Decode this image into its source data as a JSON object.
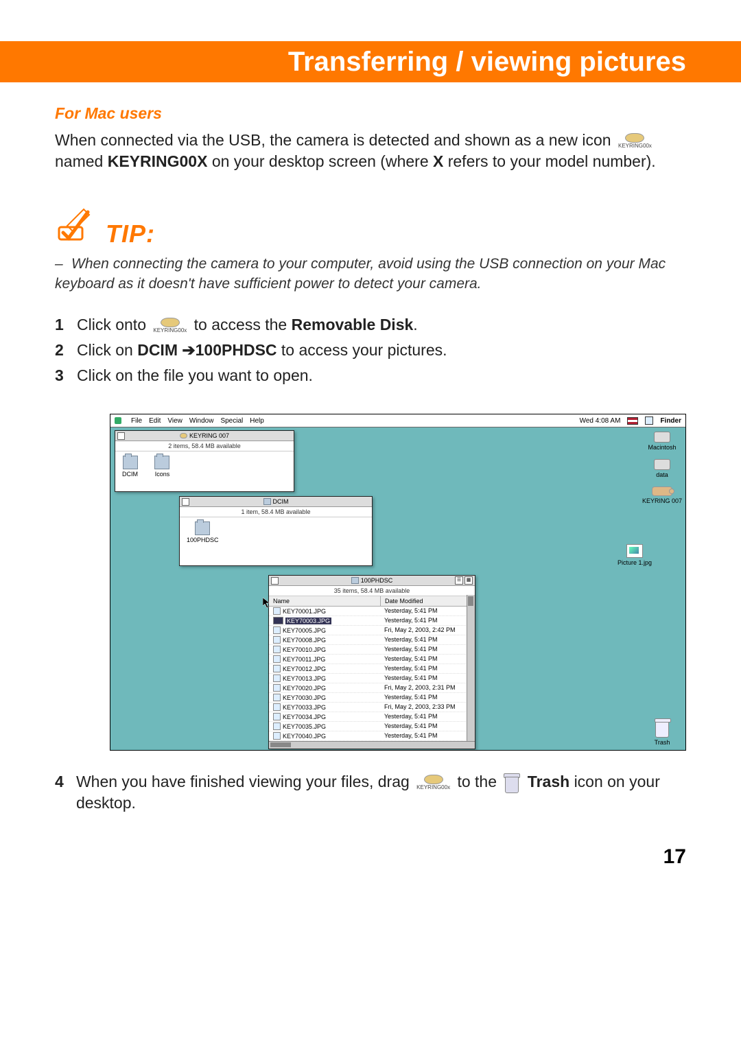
{
  "header": {
    "title": "Transferring / viewing pictures"
  },
  "section": {
    "subhead": "For Mac users",
    "intro_1": "When connected via the USB, the camera is detected and shown as a new icon",
    "intro_icon_label": "KEYRING00x",
    "intro_2a": "named ",
    "intro_2b": "KEYRING00X",
    "intro_2c": " on your desktop screen (where ",
    "intro_2d": "X",
    "intro_2e": " refers to your model number)."
  },
  "tip": {
    "label": "TIP:",
    "text": "When connecting the camera to your computer, avoid using the USB connection on your Mac keyboard as it doesn't have sufficient power to detect your camera."
  },
  "steps": [
    {
      "num": "1",
      "pre": "Click onto",
      "iconlabel": "KEYRING00x",
      "mid": "to access the ",
      "bold": "Removable Disk",
      "post": "."
    },
    {
      "num": "2",
      "pre": "Click on ",
      "bold": "DCIM ➔100PHDSC",
      "post": " to access your pictures."
    },
    {
      "num": "3",
      "pre": "Click on the file you want to open."
    }
  ],
  "mac": {
    "menu": [
      "File",
      "Edit",
      "View",
      "Window",
      "Special",
      "Help"
    ],
    "clock": "Wed 4:08 AM",
    "finder_label": "Finder",
    "desk_icons": {
      "macintosh": "Macintosh",
      "data": "data",
      "keyring": "KEYRING 007",
      "picture": "Picture 1.jpg",
      "trash": "Trash"
    },
    "win_keyring": {
      "title": "KEYRING 007",
      "status": "2 items, 58.4 MB available",
      "folders": {
        "dcim": "DCIM",
        "icons": "Icons"
      }
    },
    "win_dcim": {
      "title": "DCIM",
      "status": "1 item, 58.4 MB available",
      "folder": "100PHDSC"
    },
    "win_list": {
      "title": "100PHDSC",
      "status": "35 items, 58.4 MB available",
      "col_name": "Name",
      "col_date": "Date Modified",
      "rows": [
        {
          "n": "KEY70001.JPG",
          "d": "Yesterday, 5:41 PM"
        },
        {
          "n": "KEY70003.JPG",
          "d": "Yesterday, 5:41 PM",
          "sel": true
        },
        {
          "n": "KEY70005.JPG",
          "d": "Fri, May 2, 2003, 2:42 PM"
        },
        {
          "n": "KEY70008.JPG",
          "d": "Yesterday, 5:41 PM"
        },
        {
          "n": "KEY70010.JPG",
          "d": "Yesterday, 5:41 PM"
        },
        {
          "n": "KEY70011.JPG",
          "d": "Yesterday, 5:41 PM"
        },
        {
          "n": "KEY70012.JPG",
          "d": "Yesterday, 5:41 PM"
        },
        {
          "n": "KEY70013.JPG",
          "d": "Yesterday, 5:41 PM"
        },
        {
          "n": "KEY70020.JPG",
          "d": "Fri, May 2, 2003, 2:31 PM"
        },
        {
          "n": "KEY70030.JPG",
          "d": "Yesterday, 5:41 PM"
        },
        {
          "n": "KEY70033.JPG",
          "d": "Fri, May 2, 2003, 2:33 PM"
        },
        {
          "n": "KEY70034.JPG",
          "d": "Yesterday, 5:41 PM"
        },
        {
          "n": "KEY70035.JPG",
          "d": "Yesterday, 5:41 PM"
        },
        {
          "n": "KEY70040.JPG",
          "d": "Yesterday, 5:41 PM"
        }
      ]
    }
  },
  "step4": {
    "num": "4",
    "pre": "When you have finished viewing your files, drag",
    "iconlabel": "KEYRING00x",
    "mid": "to the",
    "bold": "Trash",
    "post": "icon on your desktop."
  },
  "page_number": "17"
}
